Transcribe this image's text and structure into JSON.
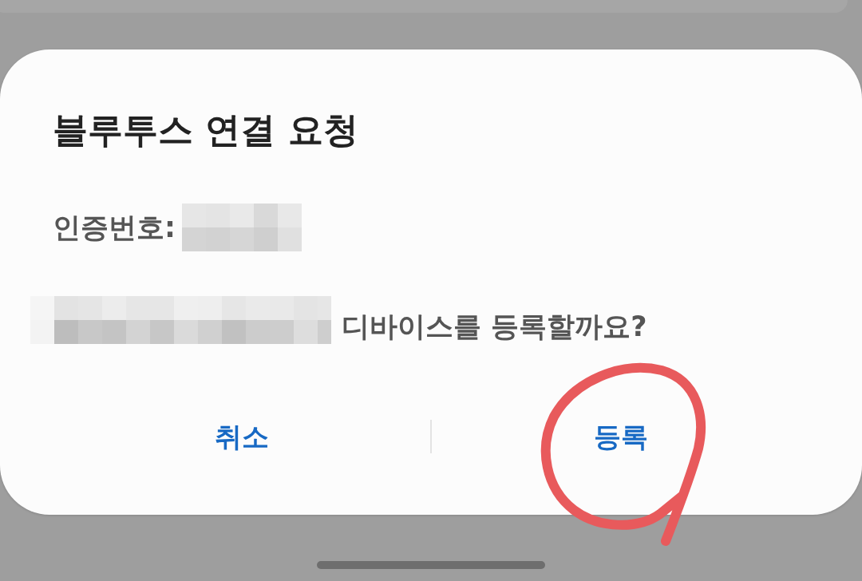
{
  "dialog": {
    "title": "블루투스 연결 요청",
    "pin": {
      "label": "인증번호:",
      "redacted": true
    },
    "device": {
      "redacted": true,
      "message": "디바이스를 등록할까요?"
    },
    "buttons": [
      {
        "label": "취소",
        "circled": false
      },
      {
        "label": "등록",
        "circled": true
      }
    ]
  }
}
